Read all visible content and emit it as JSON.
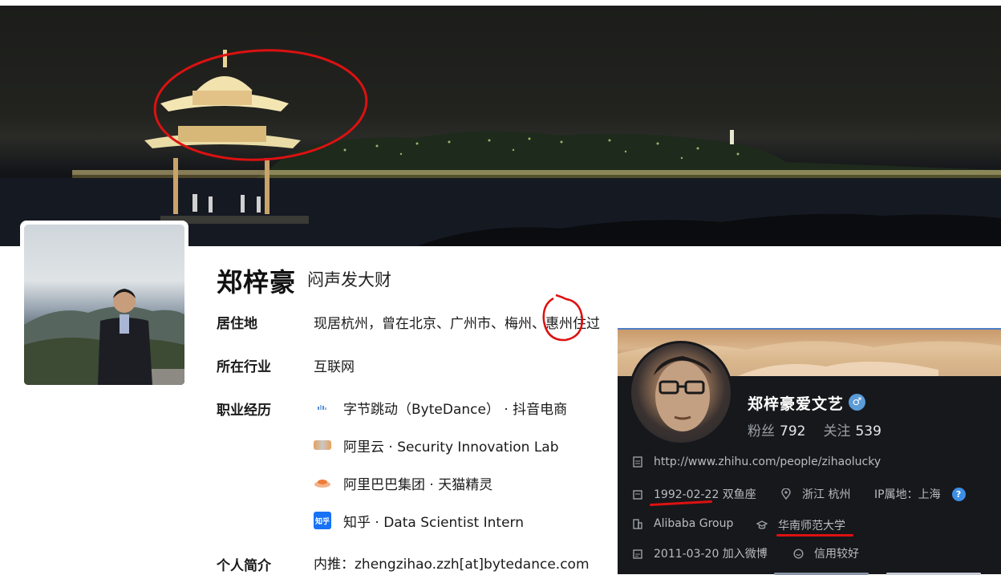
{
  "profile": {
    "name": "郑梓豪",
    "headline": "闷声发大财",
    "rows": {
      "residence_label": "居住地",
      "residence_value": "现居杭州，曾在北京、广州市、梅州、惠州住过",
      "industry_label": "所在行业",
      "industry_value": "互联网",
      "career_label": "职业经历",
      "bio_label": "个人简介",
      "bio_value": "内推：zhengzihao.zzh[at]bytedance.com"
    },
    "jobs": [
      {
        "text": "字节跳动（ByteDance） · 抖音电商",
        "icon": "bytedance-logo-icon"
      },
      {
        "text": "阿里云 · Security Innovation Lab",
        "icon": "aliyun-logo-icon"
      },
      {
        "text": "阿里巴巴集团 · 天猫精灵",
        "icon": "tmall-genie-logo-icon"
      },
      {
        "text": "知乎 · Data Scientist Intern",
        "icon": "zhihu-logo-icon",
        "logo_text": "知乎"
      }
    ]
  },
  "hover_card": {
    "name": "郑梓豪爱文艺",
    "gender_icon": "♂",
    "fans_label": "粉丝",
    "fans_count": "792",
    "follow_label": "关注",
    "follow_count": "539",
    "url": "http://www.zhihu.com/people/zihaolucky",
    "birthday": "1992-02-22 双鱼座",
    "location": "浙江 杭州",
    "ip_location": "IP属地：上海",
    "help_icon": "?",
    "company": "Alibaba Group",
    "school": "华南师范大学",
    "joined": "2011-03-20 加入微博",
    "credit": "信用较好"
  },
  "colors": {
    "annotation_red": "#dd1111",
    "hover_card_bg": "#17181c",
    "accent_blue": "#3d8fe6"
  }
}
